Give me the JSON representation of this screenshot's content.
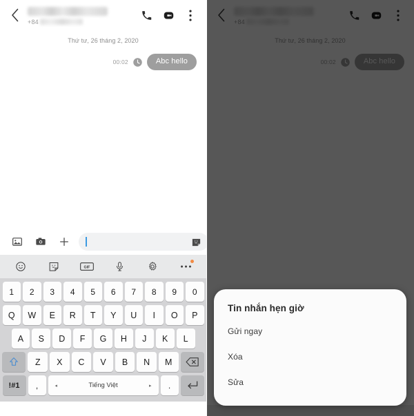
{
  "app": {
    "title": "Messages conversation",
    "contact_name_redacted": "",
    "country_code": "+84",
    "phone_redacted": ""
  },
  "header": {
    "back_icon": "back-chevron-icon",
    "call_icon": "phone-icon",
    "video_icon": "video-call-icon",
    "more_icon": "more-vertical-icon"
  },
  "thread": {
    "date_separator": "Thứ tư, 26 tháng 2, 2020",
    "messages": [
      {
        "time": "00:02",
        "status_icon": "clock-scheduled-icon",
        "text": "Abc hello",
        "outgoing": true
      }
    ]
  },
  "composer": {
    "gallery_icon": "image-icon",
    "camera_icon": "camera-icon",
    "add_icon": "plus-icon",
    "input_value": "",
    "input_placeholder": "",
    "sticker_icon": "sticker-icon",
    "voice_icon": "audio-waveform-icon"
  },
  "keyboard_toolbar": {
    "items": [
      {
        "name": "emoji-icon"
      },
      {
        "name": "sticker-icon"
      },
      {
        "name": "gif-icon",
        "label": "GIF"
      },
      {
        "name": "microphone-icon"
      },
      {
        "name": "settings-gear-icon"
      },
      {
        "name": "more-options-icon",
        "badge": true
      }
    ],
    "badge_color": "#f28a43"
  },
  "keyboard": {
    "row_numbers": [
      "1",
      "2",
      "3",
      "4",
      "5",
      "6",
      "7",
      "8",
      "9",
      "0"
    ],
    "row_qwerty": [
      "Q",
      "W",
      "E",
      "R",
      "T",
      "Y",
      "U",
      "I",
      "O",
      "P"
    ],
    "row_asdf": [
      "A",
      "S",
      "D",
      "F",
      "G",
      "H",
      "J",
      "K",
      "L"
    ],
    "row_zxcv": [
      "Z",
      "X",
      "C",
      "V",
      "B",
      "N",
      "M"
    ],
    "shift_label": "shift-key",
    "backspace_label": "backspace-key",
    "symbols_label": "!#1",
    "comma_label": ",",
    "period_label": ".",
    "space_label": "Tiếng Việt",
    "space_prev_arrow": "◂",
    "space_next_arrow": "▸",
    "enter_label": "enter-key",
    "shift_accent_color": "#4f8fd0"
  },
  "dialog": {
    "title": "Tin nhắn hẹn giờ",
    "items": [
      {
        "label": "Gửi ngay"
      },
      {
        "label": "Xóa"
      },
      {
        "label": "Sửa"
      }
    ]
  },
  "colors": {
    "bubble": "#9e9e9e",
    "keyboard_bg": "#d4d4d6",
    "key_bg": "#fdfdfd",
    "fn_key_bg": "#b9babc",
    "dim_overlay": "#000000",
    "accent_cursor": "#3b9ae1"
  }
}
